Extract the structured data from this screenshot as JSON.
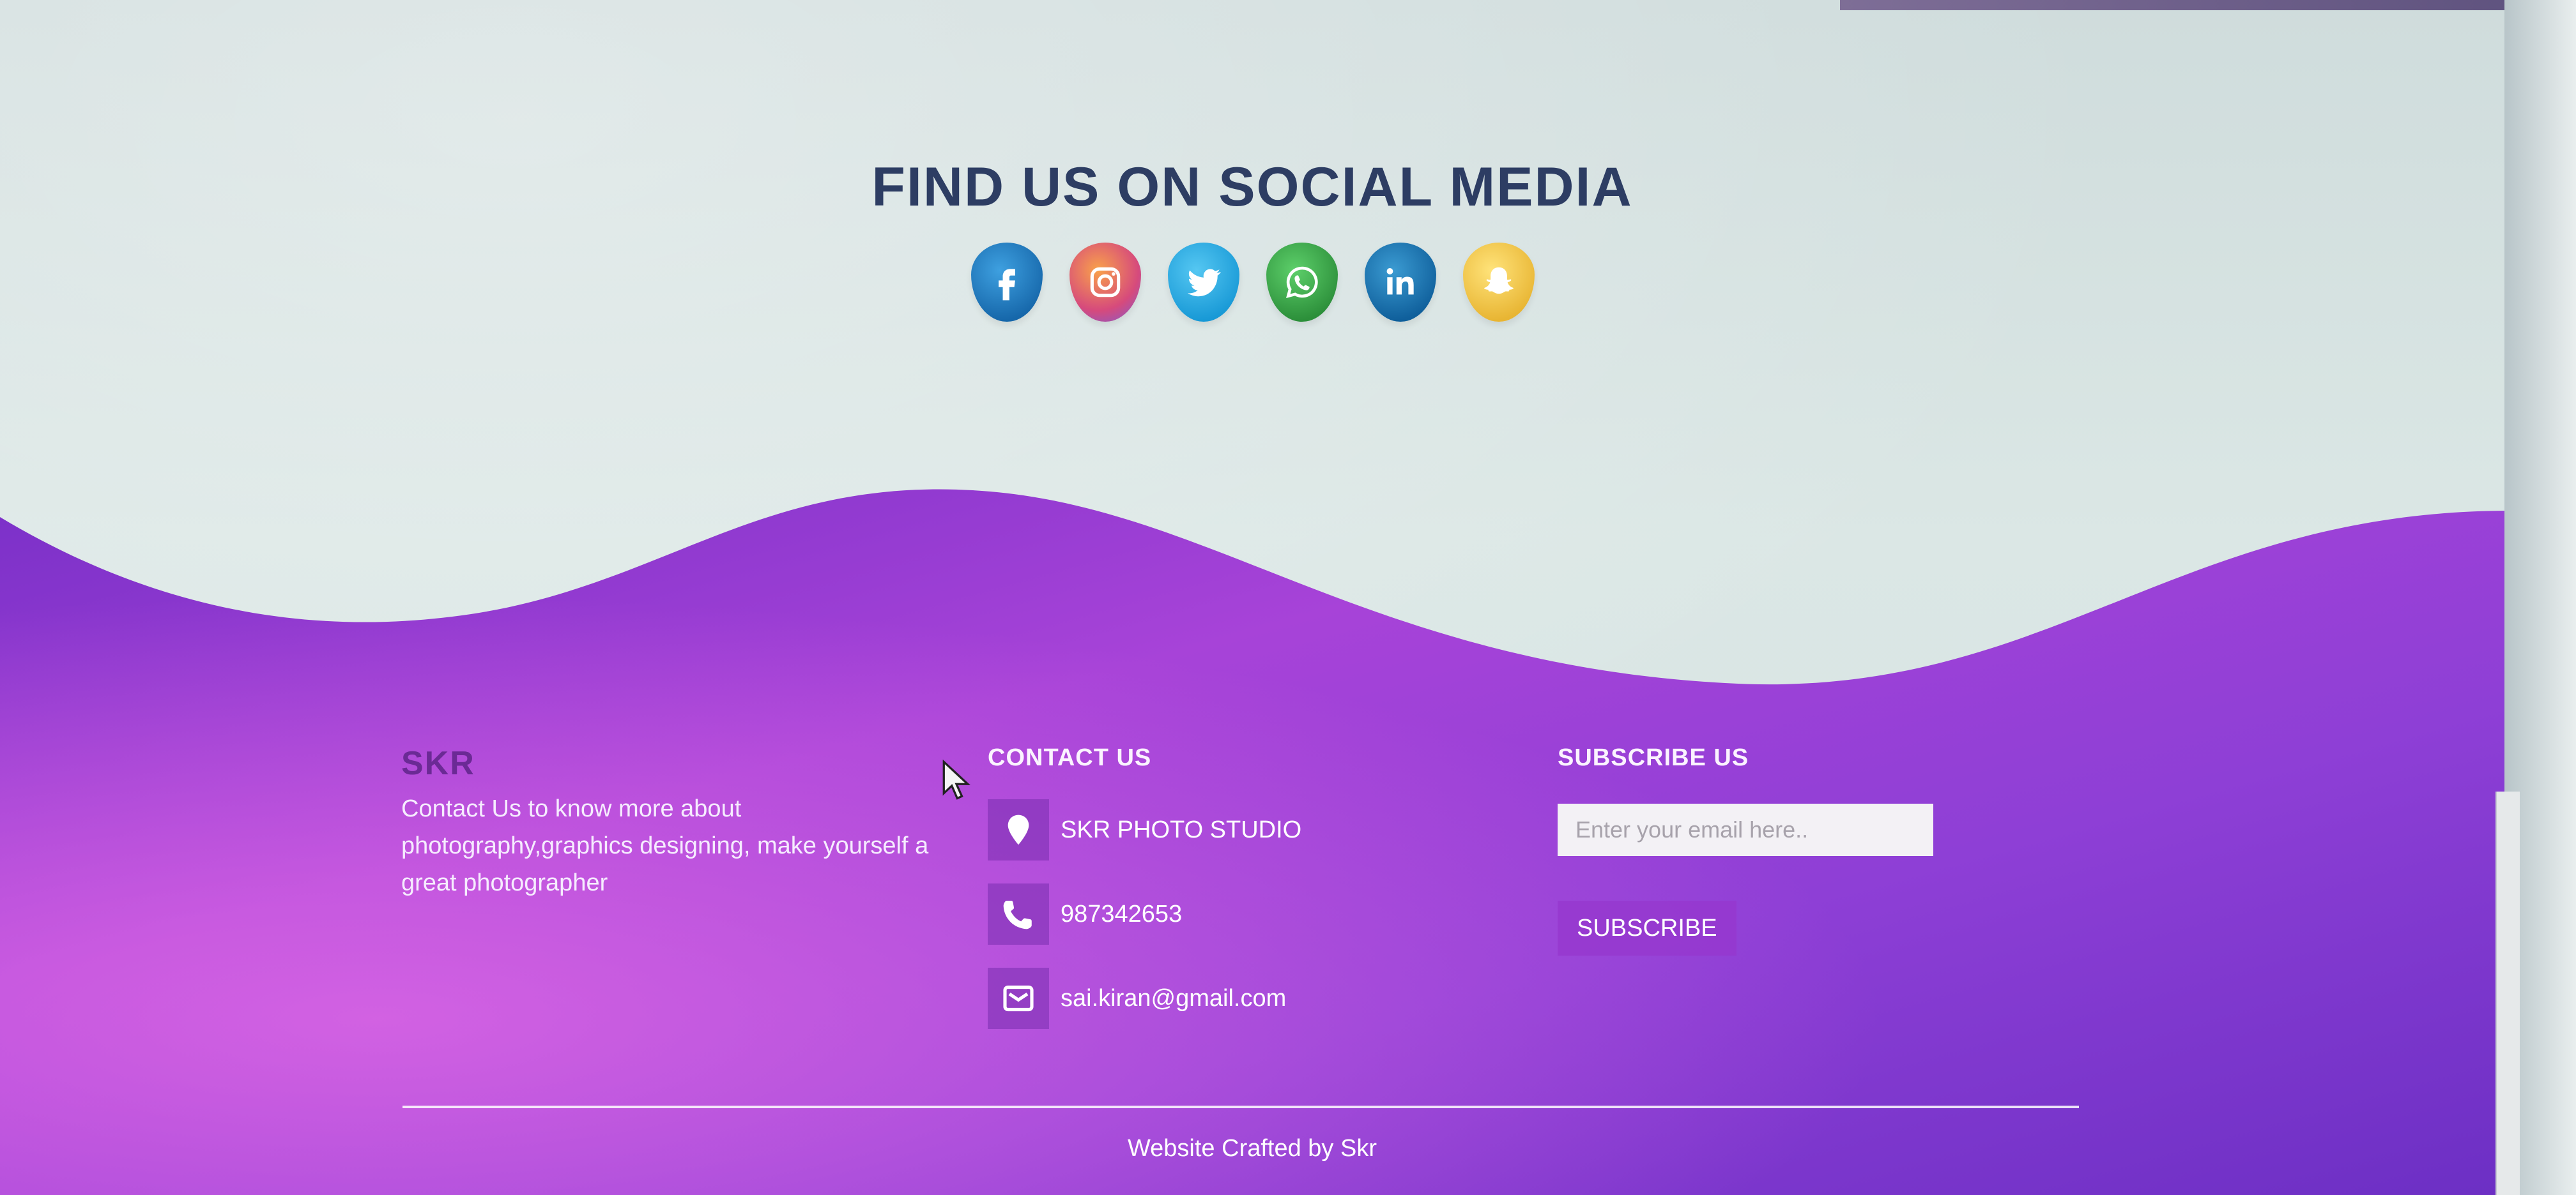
{
  "colors": {
    "page_background": "#d6e3e3",
    "title_text": "#2d3d63",
    "footer_purple": "#8a3fd0",
    "footer_magenta": "#c056e0",
    "brand_text": "#6b2a95",
    "footer_text": "#ffffff"
  },
  "social": {
    "title": "FIND US ON SOCIAL MEDIA",
    "icons": [
      {
        "name": "facebook-icon",
        "glyph": "f"
      },
      {
        "name": "instagram-icon",
        "glyph": "instagram"
      },
      {
        "name": "twitter-icon",
        "glyph": "bird"
      },
      {
        "name": "whatsapp-icon",
        "glyph": "phone-bubble"
      },
      {
        "name": "linkedin-icon",
        "glyph": "in"
      },
      {
        "name": "snapchat-icon",
        "glyph": "ghost"
      }
    ]
  },
  "footer": {
    "brand": {
      "title": "SKR",
      "description": "Contact Us to know more about photography,graphics designing, make yourself a great photographer"
    },
    "contact": {
      "heading": "CONTACT US",
      "items": [
        {
          "icon": "location-pin-icon",
          "text": "SKR PHOTO STUDIO"
        },
        {
          "icon": "phone-icon",
          "text": "987342653"
        },
        {
          "icon": "envelope-icon",
          "text": "sai.kiran@gmail.com"
        }
      ]
    },
    "subscribe": {
      "heading": "SUBSCRIBE US",
      "email_placeholder": "Enter your email here..",
      "email_value": "",
      "button_label": "SUBSCRIBE"
    },
    "credit": "Website Crafted by Skr"
  }
}
